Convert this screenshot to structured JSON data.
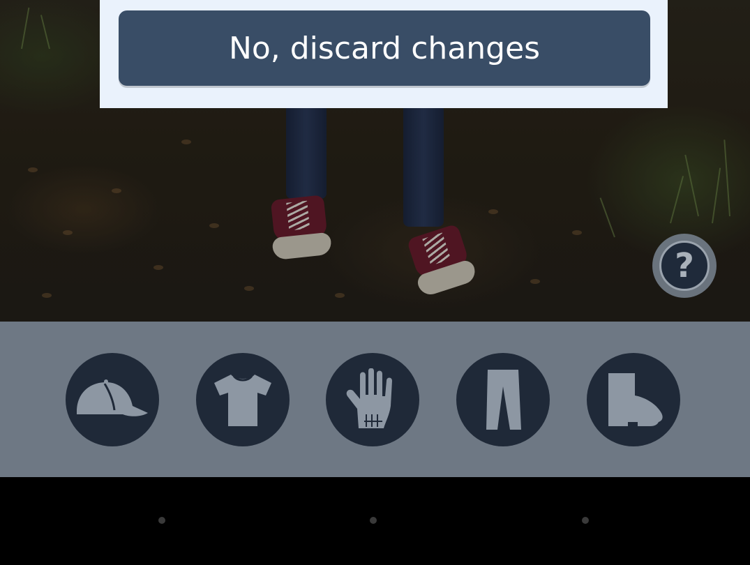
{
  "dialog": {
    "discard_label": "No, discard changes"
  },
  "help": {
    "label": "?"
  },
  "toolbar": {
    "categories": [
      {
        "name": "hat",
        "icon": "cap-icon"
      },
      {
        "name": "shirt",
        "icon": "tshirt-icon"
      },
      {
        "name": "gloves",
        "icon": "glove-icon"
      },
      {
        "name": "pants",
        "icon": "pants-icon"
      },
      {
        "name": "shoes",
        "icon": "boot-icon"
      }
    ]
  },
  "colors": {
    "dialog_bg": "#eaf2fc",
    "button_bg": "#394d66",
    "toolbar_bg": "#6e7884",
    "icon_circle": "#1f2938",
    "icon_fill": "#8d97a3"
  }
}
